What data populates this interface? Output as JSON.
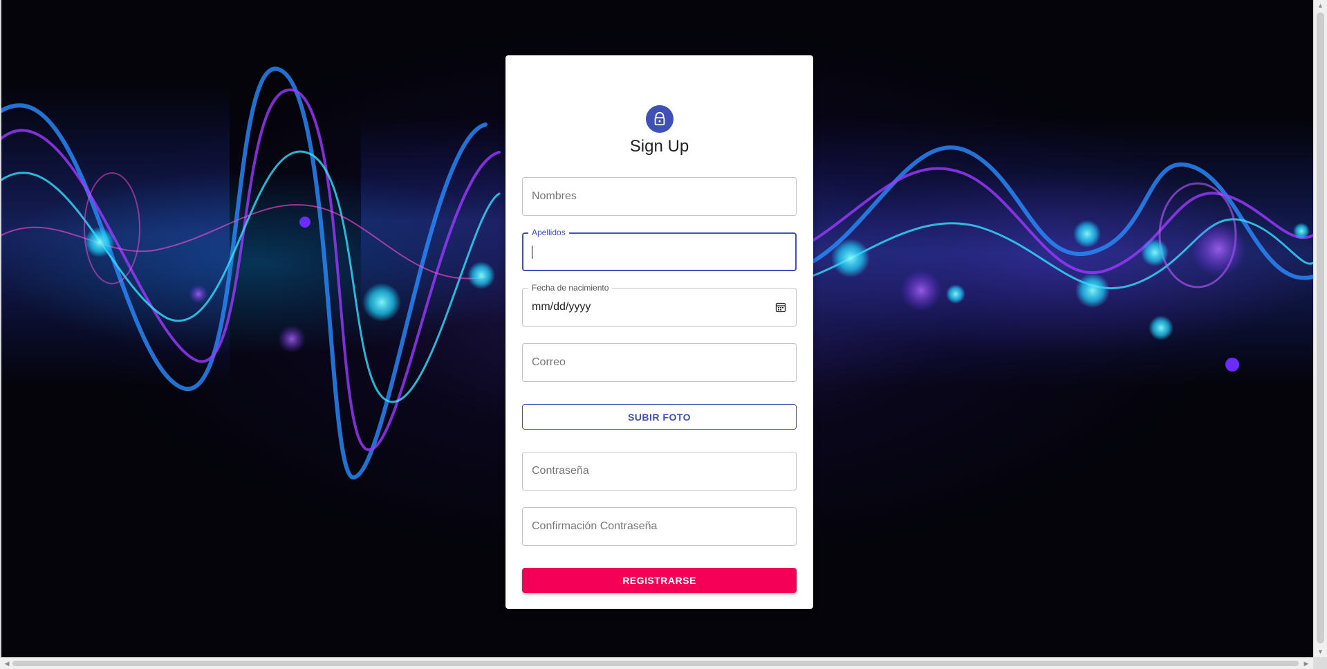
{
  "background": {
    "image_name": "neon-sound-wave-background",
    "accent_colors": [
      "#1e90ff",
      "#00e5ff",
      "#8a2be2",
      "#ff4fd8"
    ]
  },
  "form": {
    "icon": "lock-icon",
    "icon_color": "#3f51b5",
    "title": "Sign Up",
    "fields": {
      "first_name": {
        "label": "Nombres",
        "value": ""
      },
      "last_name": {
        "label": "Apellidos",
        "value": "",
        "focused": true
      },
      "birth_date": {
        "label": "Fecha de nacimiento",
        "placeholder": "mm/dd/yyyy"
      },
      "email": {
        "label": "Correo",
        "value": ""
      },
      "password": {
        "label": "Contraseña",
        "value": ""
      },
      "password_confirm": {
        "label": "Confirmación Contraseña",
        "value": ""
      }
    },
    "upload_button_label": "SUBIR FOTO",
    "submit_button_label": "REGISTRARSE",
    "primary_color": "#3f51b5",
    "submit_color": "#f50057"
  }
}
